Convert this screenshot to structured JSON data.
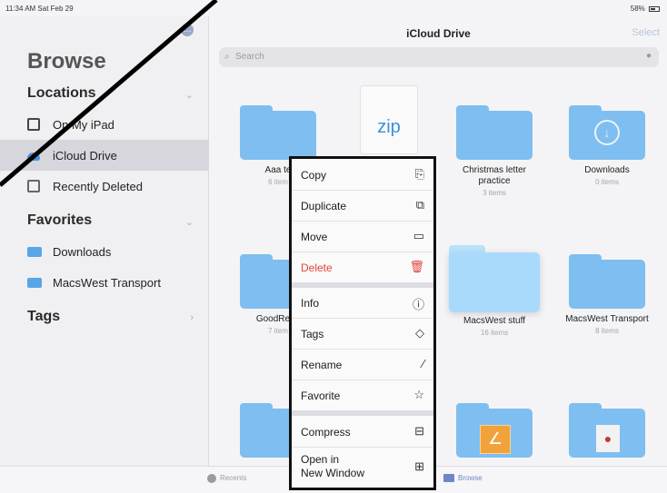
{
  "status_bar": {
    "time": "11:34 AM  Sat Feb 29",
    "battery": "58%"
  },
  "sidebar": {
    "title": "Browse",
    "locations_header": "Locations",
    "locations": [
      {
        "label": "On My iPad",
        "icon": "ipad-icon"
      },
      {
        "label": "iCloud Drive",
        "icon": "icloud-icon",
        "selected": true
      },
      {
        "label": "Recently Deleted",
        "icon": "trash-icon"
      }
    ],
    "favorites_header": "Favorites",
    "favorites": [
      {
        "label": "Downloads",
        "icon": "folder-icon"
      },
      {
        "label": "MacsWest Transport",
        "icon": "folder-icon"
      }
    ],
    "tags_header": "Tags"
  },
  "main": {
    "title": "iCloud Drive",
    "select_label": "Select",
    "search_placeholder": "Search",
    "tiles": [
      {
        "name": "Aaa te",
        "count": "6 item"
      },
      {
        "name": "zip",
        "count": ""
      },
      {
        "name": "Christmas letter practice",
        "count": "3 items"
      },
      {
        "name": "Downloads",
        "count": "0 items"
      },
      {
        "name": "GoodRead",
        "count": "7 item"
      },
      {
        "name": "MacsWest stuff",
        "count": "16 items"
      },
      {
        "name": "MacsWest Transport",
        "count": "8 items"
      }
    ]
  },
  "context_menu": {
    "items": [
      {
        "label": "Copy",
        "icon": "copy-icon",
        "glyph": "⎘"
      },
      {
        "label": "Duplicate",
        "icon": "duplicate-icon",
        "glyph": "⧉"
      },
      {
        "label": "Move",
        "icon": "folder-outline-icon",
        "glyph": "▭"
      },
      {
        "label": "Delete",
        "icon": "trash-icon",
        "glyph": "🗑"
      },
      {
        "label": "Info",
        "icon": "info-icon",
        "glyph": "ⓘ"
      },
      {
        "label": "Tags",
        "icon": "tag-icon",
        "glyph": "◇"
      },
      {
        "label": "Rename",
        "icon": "pencil-icon",
        "glyph": "⁄"
      },
      {
        "label": "Favorite",
        "icon": "star-icon",
        "glyph": "☆"
      },
      {
        "label": "Compress",
        "icon": "archive-icon",
        "glyph": "⊟"
      },
      {
        "label": "Open in New Window",
        "label_line1": "Open in",
        "label_line2": "New Window",
        "icon": "grid-icon",
        "glyph": "⊞"
      }
    ]
  },
  "tabbar": {
    "recents_label": "Recents",
    "browse_label": "Browse"
  },
  "colors": {
    "accent": "#4b93e0",
    "folder": "#7fbef0",
    "delete": "#e0453a"
  }
}
